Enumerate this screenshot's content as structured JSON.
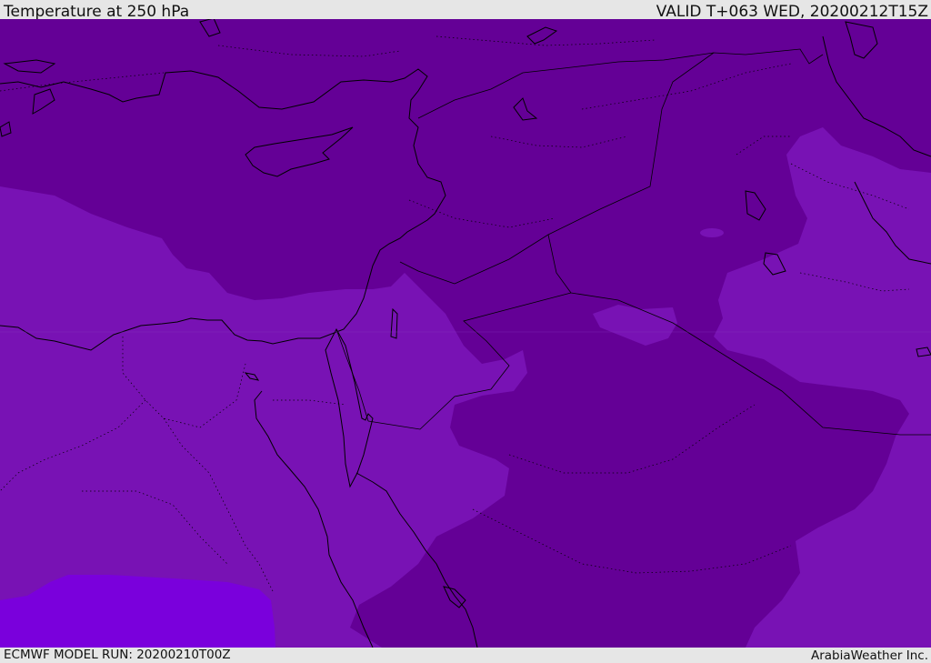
{
  "header": {
    "title": "Temperature at 250 hPa",
    "valid": "VALID T+063 WED, 20200212T15Z"
  },
  "footer": {
    "model_run": "ECMWF MODEL RUN: 20200210T00Z",
    "credit": "ArabiaWeather Inc."
  },
  "map": {
    "colors": {
      "dark_band": "#640096",
      "mid_band": "#7812b4",
      "warm_band": "#7a00dc",
      "coastline": "#000000"
    }
  }
}
